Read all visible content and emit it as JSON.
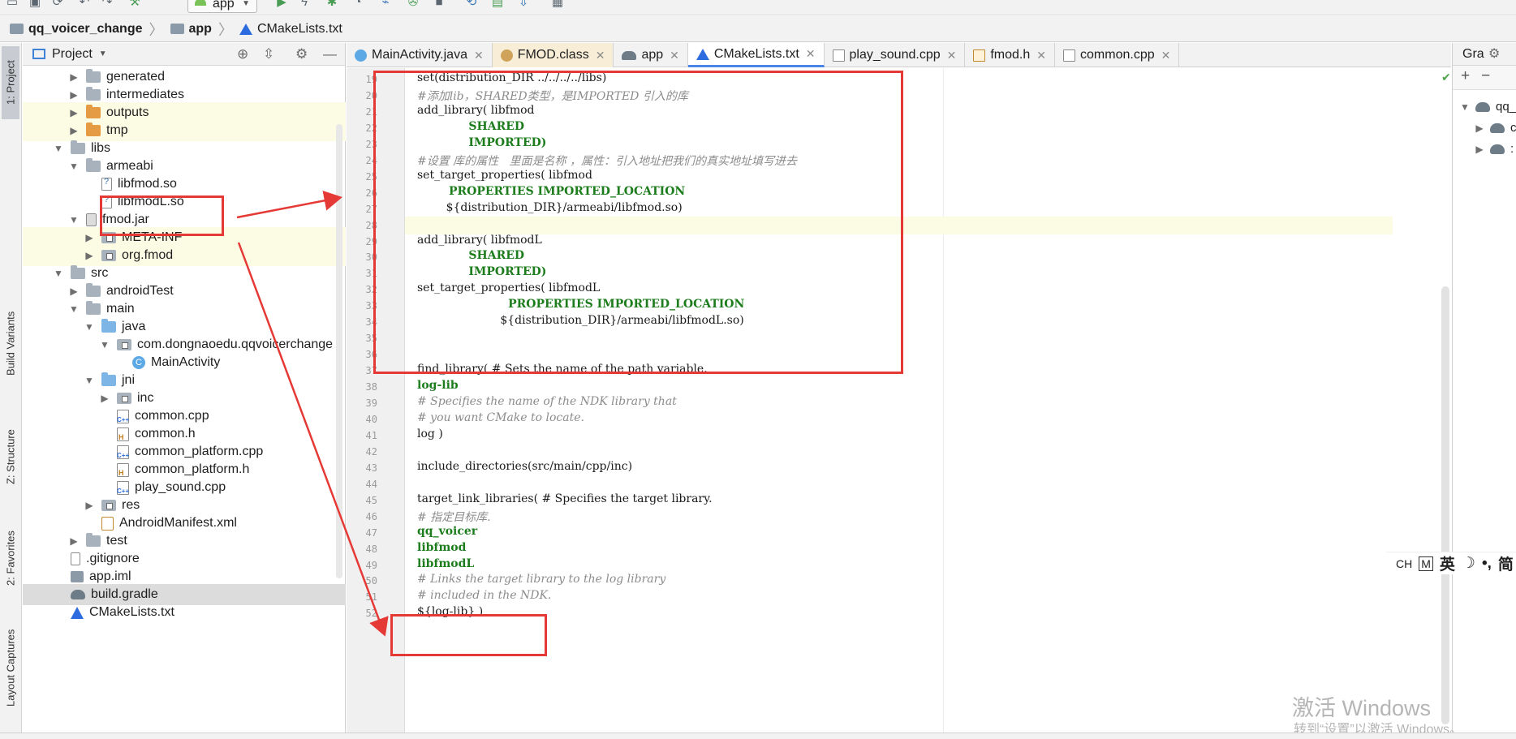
{
  "toolbar": {
    "run_config": "app",
    "icons": [
      "open-folder-icon",
      "save-icon",
      "sync-icon",
      "undo-icon",
      "redo-icon",
      "hammer-icon",
      "run-icon",
      "debug-icon",
      "profile-icon",
      "attach-icon",
      "apply-changes-icon",
      "stop-icon",
      "sync-gradle-icon",
      "avd-manager-icon",
      "sdk-manager-icon",
      "structure-icon"
    ]
  },
  "breadcrumb": [
    "qq_voicer_change",
    "app",
    "CMakeLists.txt"
  ],
  "left_stripe": [
    "1: Project",
    "Build Variants",
    "Z: Structure",
    "2: Favorites",
    "Layout Captures"
  ],
  "project_panel": {
    "title": "Project",
    "tree": [
      {
        "label": "generated",
        "icon": "folder",
        "depth": 2,
        "expand": "closed"
      },
      {
        "label": "intermediates",
        "icon": "folder",
        "depth": 2,
        "expand": "closed"
      },
      {
        "label": "outputs",
        "icon": "folder-orange",
        "depth": 2,
        "expand": "closed"
      },
      {
        "label": "tmp",
        "icon": "folder-orange",
        "depth": 2,
        "expand": "closed"
      },
      {
        "label": "libs",
        "icon": "folder",
        "depth": 1,
        "expand": "open"
      },
      {
        "label": "armeabi",
        "icon": "folder",
        "depth": 2,
        "expand": "open"
      },
      {
        "label": "libfmod.so",
        "icon": "so-file",
        "depth": 3,
        "expand": "none"
      },
      {
        "label": "libfmodL.so",
        "icon": "so-file",
        "depth": 3,
        "expand": "none"
      },
      {
        "label": "fmod.jar",
        "icon": "jar-file",
        "depth": 2,
        "expand": "open"
      },
      {
        "label": "META-INF",
        "icon": "package",
        "depth": 3,
        "expand": "closed"
      },
      {
        "label": "org.fmod",
        "icon": "package",
        "depth": 3,
        "expand": "closed"
      },
      {
        "label": "src",
        "icon": "folder",
        "depth": 1,
        "expand": "open"
      },
      {
        "label": "androidTest",
        "icon": "folder",
        "depth": 2,
        "expand": "closed"
      },
      {
        "label": "main",
        "icon": "folder",
        "depth": 2,
        "expand": "open"
      },
      {
        "label": "java",
        "icon": "folder-blue",
        "depth": 3,
        "expand": "open"
      },
      {
        "label": "com.dongnaoedu.qqvoicerchange",
        "icon": "package",
        "depth": 4,
        "expand": "open"
      },
      {
        "label": "MainActivity",
        "icon": "class",
        "depth": 5,
        "expand": "none"
      },
      {
        "label": "jni",
        "icon": "folder-blue",
        "depth": 3,
        "expand": "open"
      },
      {
        "label": "inc",
        "icon": "package",
        "depth": 4,
        "expand": "closed"
      },
      {
        "label": "common.cpp",
        "icon": "cpp-file",
        "depth": 4,
        "expand": "none"
      },
      {
        "label": "common.h",
        "icon": "h-file",
        "depth": 4,
        "expand": "none"
      },
      {
        "label": "common_platform.cpp",
        "icon": "cpp-file",
        "depth": 4,
        "expand": "none"
      },
      {
        "label": "common_platform.h",
        "icon": "h-file",
        "depth": 4,
        "expand": "none"
      },
      {
        "label": "play_sound.cpp",
        "icon": "cpp-file",
        "depth": 4,
        "expand": "none"
      },
      {
        "label": "res",
        "icon": "package",
        "depth": 3,
        "expand": "closed"
      },
      {
        "label": "AndroidManifest.xml",
        "icon": "xml-file",
        "depth": 3,
        "expand": "none"
      },
      {
        "label": "test",
        "icon": "folder",
        "depth": 2,
        "expand": "closed"
      },
      {
        "label": ".gitignore",
        "icon": "text-file",
        "depth": 1,
        "expand": "none"
      },
      {
        "label": "app.iml",
        "icon": "iml-file",
        "depth": 1,
        "expand": "none"
      },
      {
        "label": "build.gradle",
        "icon": "gradle-file",
        "depth": 1,
        "expand": "none"
      },
      {
        "label": "CMakeLists.txt",
        "icon": "cmake-file",
        "depth": 1,
        "expand": "none"
      }
    ]
  },
  "editor": {
    "tabs": [
      {
        "label": "MainActivity.java",
        "icon": "java",
        "active": false
      },
      {
        "label": "FMOD.class",
        "icon": "cls",
        "active": false
      },
      {
        "label": "app",
        "icon": "gradle",
        "active": false
      },
      {
        "label": "CMakeLists.txt",
        "icon": "cmake",
        "active": true
      },
      {
        "label": "play_sound.cpp",
        "icon": "cpp",
        "active": false
      },
      {
        "label": "fmod.h",
        "icon": "h",
        "active": false
      },
      {
        "label": "common.cpp",
        "icon": "cpp",
        "active": false
      }
    ],
    "current_line": 28,
    "lines": [
      {
        "n": 19,
        "t": "set(distribution_DIR ../../../../libs)",
        "k": "code"
      },
      {
        "n": 20,
        "t": "#添加lib，SHARED类型，是IMPORTED 引入的库",
        "k": "comment"
      },
      {
        "n": 21,
        "t": "add_library( libfmod",
        "k": "code"
      },
      {
        "n": 22,
        "t": "             SHARED",
        "k": "kw"
      },
      {
        "n": 23,
        "t": "             IMPORTED)",
        "k": "kw"
      },
      {
        "n": 24,
        "t": "#设置 库的属性   里面是名称 ，属性：引入地址把我们的真实地址填写进去",
        "k": "comment"
      },
      {
        "n": 25,
        "t": "set_target_properties( libfmod",
        "k": "code"
      },
      {
        "n": 26,
        "t": "        PROPERTIES IMPORTED_LOCATION",
        "k": "kw"
      },
      {
        "n": 27,
        "t": "        ${distribution_DIR}/armeabi/libfmod.so)",
        "k": "code"
      },
      {
        "n": 28,
        "t": "",
        "k": "code"
      },
      {
        "n": 29,
        "t": "add_library( libfmodL",
        "k": "code"
      },
      {
        "n": 30,
        "t": "             SHARED",
        "k": "kw"
      },
      {
        "n": 31,
        "t": "             IMPORTED)",
        "k": "kw"
      },
      {
        "n": 32,
        "t": "set_target_properties( libfmodL",
        "k": "code"
      },
      {
        "n": 33,
        "t": "                       PROPERTIES IMPORTED_LOCATION",
        "k": "kw"
      },
      {
        "n": 34,
        "t": "                       ${distribution_DIR}/armeabi/libfmodL.so)",
        "k": "code"
      },
      {
        "n": 35,
        "t": "",
        "k": "code"
      },
      {
        "n": 36,
        "t": "",
        "k": "code"
      },
      {
        "n": 37,
        "t": "find_library( # Sets the name of the path variable.",
        "k": "code"
      },
      {
        "n": 38,
        "t": "log-lib",
        "k": "kw"
      },
      {
        "n": 39,
        "t": "# Specifies the name of the NDK library that",
        "k": "comment"
      },
      {
        "n": 40,
        "t": "# you want CMake to locate.",
        "k": "comment"
      },
      {
        "n": 41,
        "t": "log )",
        "k": "code"
      },
      {
        "n": 42,
        "t": "",
        "k": "code"
      },
      {
        "n": 43,
        "t": "include_directories(src/main/cpp/inc)",
        "k": "code"
      },
      {
        "n": 44,
        "t": "",
        "k": "code"
      },
      {
        "n": 45,
        "t": "target_link_libraries( # Specifies the target library.",
        "k": "code"
      },
      {
        "n": 46,
        "t": "# 指定目标库.",
        "k": "comment"
      },
      {
        "n": 47,
        "t": "qq_voicer",
        "k": "kw"
      },
      {
        "n": 48,
        "t": "libfmod",
        "k": "kw"
      },
      {
        "n": 49,
        "t": "libfmodL",
        "k": "kw"
      },
      {
        "n": 50,
        "t": "# Links the target library to the log library",
        "k": "comment"
      },
      {
        "n": 51,
        "t": "# included in the NDK.",
        "k": "comment"
      },
      {
        "n": 52,
        "t": "${log-lib} )",
        "k": "code"
      }
    ]
  },
  "gradle_panel": {
    "title": "Gra",
    "root": "qq_",
    "children": [
      "c",
      ":"
    ]
  },
  "ime_bar": {
    "ch": "CH",
    "m": "M",
    "lang": "英",
    "mode": "简"
  },
  "watermark": {
    "title": "激活 Windows",
    "subtitle": "转到“设置”以激活 Windows。"
  },
  "colors": {
    "annotation": "#e53935",
    "keyword": "#1d7d1d",
    "comment": "#8c8c8c",
    "current_line": "#fcfbe4",
    "tab_active": "#4a86e8"
  }
}
